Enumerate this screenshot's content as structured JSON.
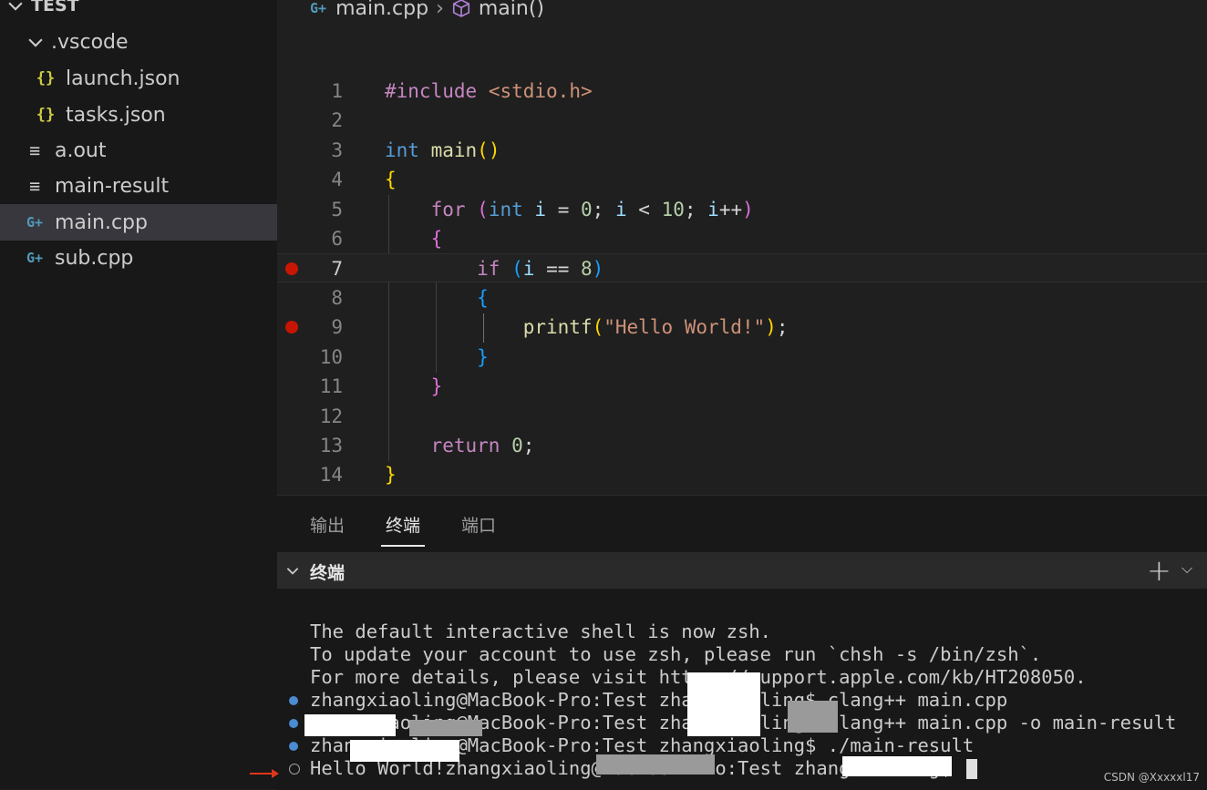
{
  "explorer": {
    "root_label": "TEST",
    "items": [
      {
        "label": ".vscode",
        "icon": "chevron-down-icon"
      },
      {
        "label": "launch.json",
        "icon_glyph": "{}",
        "icon": "json-icon"
      },
      {
        "label": "tasks.json",
        "icon_glyph": "{}",
        "icon": "json-icon"
      },
      {
        "label": "a.out",
        "icon_glyph": "≡",
        "icon": "file-lines-icon"
      },
      {
        "label": "main-result",
        "icon_glyph": "≡",
        "icon": "file-lines-icon"
      },
      {
        "label": "main.cpp",
        "icon_glyph": "G+",
        "icon": "cpp-icon",
        "selected": true
      },
      {
        "label": "sub.cpp",
        "icon_glyph": "G+",
        "icon": "cpp-icon"
      }
    ]
  },
  "breadcrumb": {
    "file": "main.cpp",
    "symbol": "main()"
  },
  "editor": {
    "lines": [
      {
        "num": "1"
      },
      {
        "num": "2"
      },
      {
        "num": "3"
      },
      {
        "num": "4"
      },
      {
        "num": "5"
      },
      {
        "num": "6"
      },
      {
        "num": "7"
      },
      {
        "num": "8"
      },
      {
        "num": "9"
      },
      {
        "num": "10"
      },
      {
        "num": "11"
      },
      {
        "num": "12"
      },
      {
        "num": "13"
      },
      {
        "num": "14"
      }
    ],
    "code": {
      "l1_directive": "#include",
      "l1_header": "<stdio.h>",
      "l3_type": "int",
      "l3_name": "main",
      "l5_for": "for",
      "l5_int": "int",
      "l5_i": "i",
      "l5_eq": " = ",
      "l5_zero": "0",
      "l5_semi1": "; ",
      "l5_i2": "i",
      "l5_lt": " < ",
      "l5_ten": "10",
      "l5_semi2": "; ",
      "l5_i3": "i",
      "l5_inc": "++",
      "l7_if": "if",
      "l7_i": "i",
      "l7_op": " == ",
      "l7_eight": "8",
      "l9_fn": "printf",
      "l9_str": "\"Hello World!\"",
      "l9_end": ";",
      "l13_return": "return",
      "l13_zero": "0",
      "l13_semi": ";"
    },
    "breakpoint_lines": [
      "7",
      "9"
    ],
    "active_line": "7"
  },
  "panel": {
    "tabs": [
      "输出",
      "终端",
      "端口"
    ],
    "active_tab": "终端",
    "terminal_title": "终端",
    "add_glyph": "+",
    "dropdown_glyph": "⌵",
    "lines": [
      "The default interactive shell is now zsh.",
      "To update your account to use zsh, please run `chsh -s /bin/zsh`.",
      "For more details, please visit https://support.apple.com/kb/HT208050."
    ],
    "prompts": [
      {
        "text": "zhangxiaoling@MacBook-Pro:Test zhangxiaoling$ clang++ main.cpp"
      },
      {
        "text": "zhangxiaoling@MacBook-Pro:Test zhangxiaoling$ clang++ main.cpp -o main-result"
      },
      {
        "text": "zhangxiaoling@MacBook-Pro:Test zhangxiaoling$ ./main-result"
      },
      {
        "text": "Hello World!zhangxiaoling@MacBook-Pro:Test zhangxiaoling$ "
      }
    ]
  },
  "watermark": "CSDN @Xxxxxl17",
  "colors": {
    "breakpoint": "#e51400",
    "keyword": "#c586c0",
    "type": "#569cd6",
    "string": "#ce9178",
    "number": "#b5cea8"
  }
}
